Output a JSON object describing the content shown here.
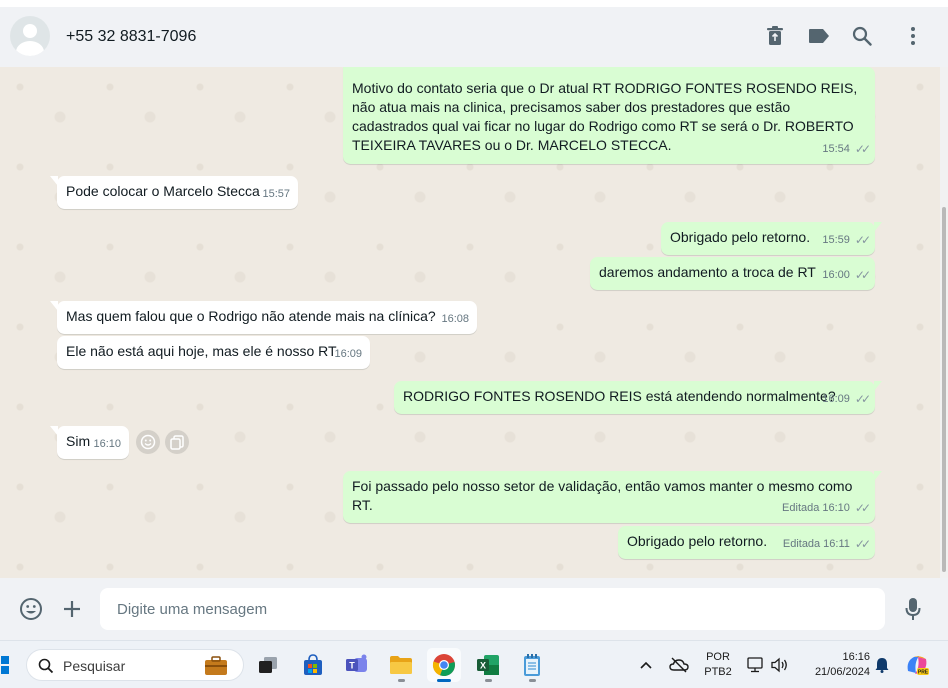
{
  "header": {
    "contact_name": "+55 32 8831-7096",
    "icons": [
      "delete-icon",
      "label-icon",
      "search-icon",
      "menu-icon"
    ]
  },
  "messages": [
    {
      "direction": "out",
      "text": "Motivo do contato seria que o Dr atual RT RODRIGO FONTES ROSENDO REIS, não atua mais na clinica, precisamos saber dos prestadores que estão cadastrados qual vai ficar no lugar do Rodrigo como RT se será o Dr. ROBERTO TEIXEIRA TAVARES ou o Dr. MARCELO STECCA.",
      "time": "15:54",
      "edited": ""
    },
    {
      "direction": "in",
      "text": "Pode colocar o Marcelo Stecca",
      "time": "15:57",
      "edited": ""
    },
    {
      "direction": "out",
      "text": "Obrigado pelo retorno.",
      "time": "15:59",
      "edited": ""
    },
    {
      "direction": "out",
      "text": "daremos andamento a troca de RT",
      "time": "16:00",
      "edited": ""
    },
    {
      "direction": "in",
      "text": "Mas quem falou que o Rodrigo não atende mais na clínica?",
      "time": "16:08",
      "edited": ""
    },
    {
      "direction": "in",
      "text": "Ele não está aqui hoje, mas ele é nosso RT",
      "time": "16:09",
      "edited": ""
    },
    {
      "direction": "out",
      "text": "RODRIGO FONTES ROSENDO REIS está atendendo normalmente?",
      "time": "16:09",
      "edited": ""
    },
    {
      "direction": "in",
      "text": "Sim",
      "time": "16:10",
      "edited": ""
    },
    {
      "direction": "out",
      "text": "Foi passado pelo nosso setor de validação, então vamos manter o mesmo como RT.",
      "time": "16:10",
      "edited": "Editada"
    },
    {
      "direction": "out",
      "text": "Obrigado pelo retorno.",
      "time": "16:11",
      "edited": "Editada"
    }
  ],
  "composer": {
    "placeholder": "Digite uma mensagem"
  },
  "taskbar": {
    "search_label": "Pesquisar",
    "lang_line1": "POR",
    "lang_line2": "PTB2",
    "time": "16:16",
    "date": "21/06/2024"
  },
  "colors": {
    "outgoing_bubble": "#d9fdd3",
    "incoming_bubble": "#ffffff",
    "chat_background": "#efeae2",
    "header_background": "#f0f2f5"
  }
}
